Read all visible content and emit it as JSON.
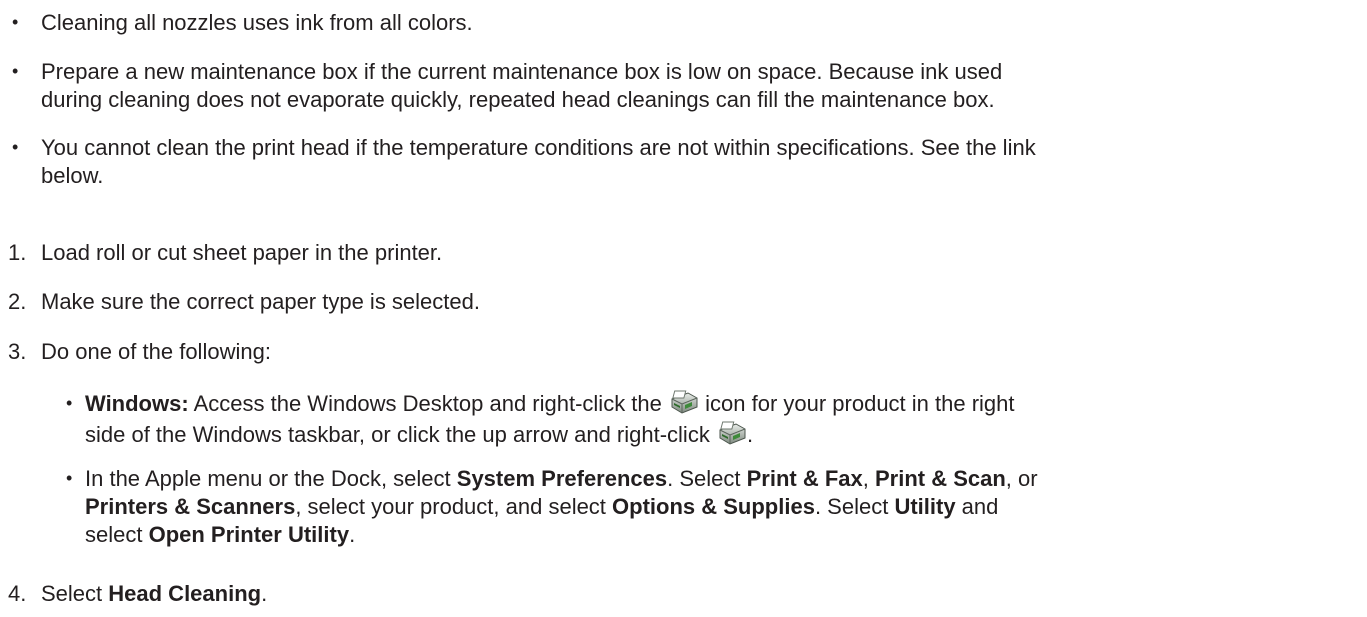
{
  "notes": [
    {
      "lines": [
        "Cleaning all nozzles uses ink from all colors."
      ]
    },
    {
      "lines": [
        "Prepare a new maintenance box if the current maintenance box is low on space. Because ink used",
        "during cleaning does not evaporate quickly, repeated head cleanings can fill the maintenance box."
      ]
    },
    {
      "lines": [
        "You cannot clean the print head if the temperature conditions are not within specifications. See the link",
        "below."
      ]
    }
  ],
  "bullet_char": "•",
  "steps": [
    {
      "number": "1.",
      "text": "Load roll or cut sheet paper in the printer."
    },
    {
      "number": "2.",
      "text": "Make sure the correct paper type is selected."
    },
    {
      "number": "3.",
      "text": "Do one of the following:"
    },
    {
      "number": "4.",
      "text_pre": "Select ",
      "bold": "Head Cleaning",
      "text_post": "."
    }
  ],
  "windows_option": {
    "label": "Windows:",
    "line1_pre": " Access the Windows Desktop and right-click the ",
    "line1_post": " icon for your product in the right",
    "line2_pre": "side of the Windows taskbar, or click the up arrow and right-click ",
    "line2_post": "."
  },
  "mac_option": {
    "l1_a": "In the Apple menu or the Dock, select ",
    "l1_b": "System Preferences",
    "l1_c": ". Select ",
    "l1_d": "Print & Fax",
    "l1_e": ", ",
    "l1_f": "Print & Scan",
    "l1_g": ", or",
    "l2_a": "Printers & Scanners",
    "l2_b": ", select your product, and select ",
    "l2_c": "Options & Supplies",
    "l2_d": ". Select ",
    "l2_e": "Utility",
    "l2_f": " and",
    "l3_a": "select ",
    "l3_b": "Open Printer Utility",
    "l3_c": "."
  },
  "icons": {
    "printer_tray": "printer-tray-icon"
  },
  "colors": {
    "text": "#231f20"
  }
}
